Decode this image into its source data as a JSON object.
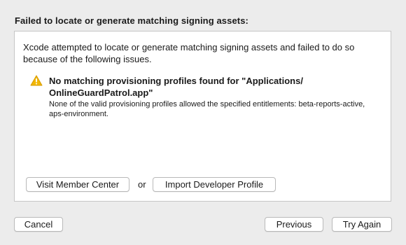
{
  "dialog": {
    "title": "Failed to locate or generate matching signing assets:",
    "description": "Xcode attempted to locate or generate matching signing assets and failed to do so because of the following issues."
  },
  "issue": {
    "icon": "warning-icon",
    "title": "No matching provisioning profiles found for \"Applications/ OnlineGuardPatrol.app\"",
    "detail": "None of the valid provisioning profiles allowed the specified entitlements: beta-reports-active, aps-environment."
  },
  "actions": {
    "visit_label": "Visit Member Center",
    "or_label": "or",
    "import_label": "Import Developer Profile"
  },
  "footer": {
    "cancel_label": "Cancel",
    "previous_label": "Previous",
    "try_again_label": "Try Again"
  },
  "colors": {
    "window_background": "#ececec",
    "panel_background": "#ffffff",
    "warning_yellow": "#f2b705"
  }
}
